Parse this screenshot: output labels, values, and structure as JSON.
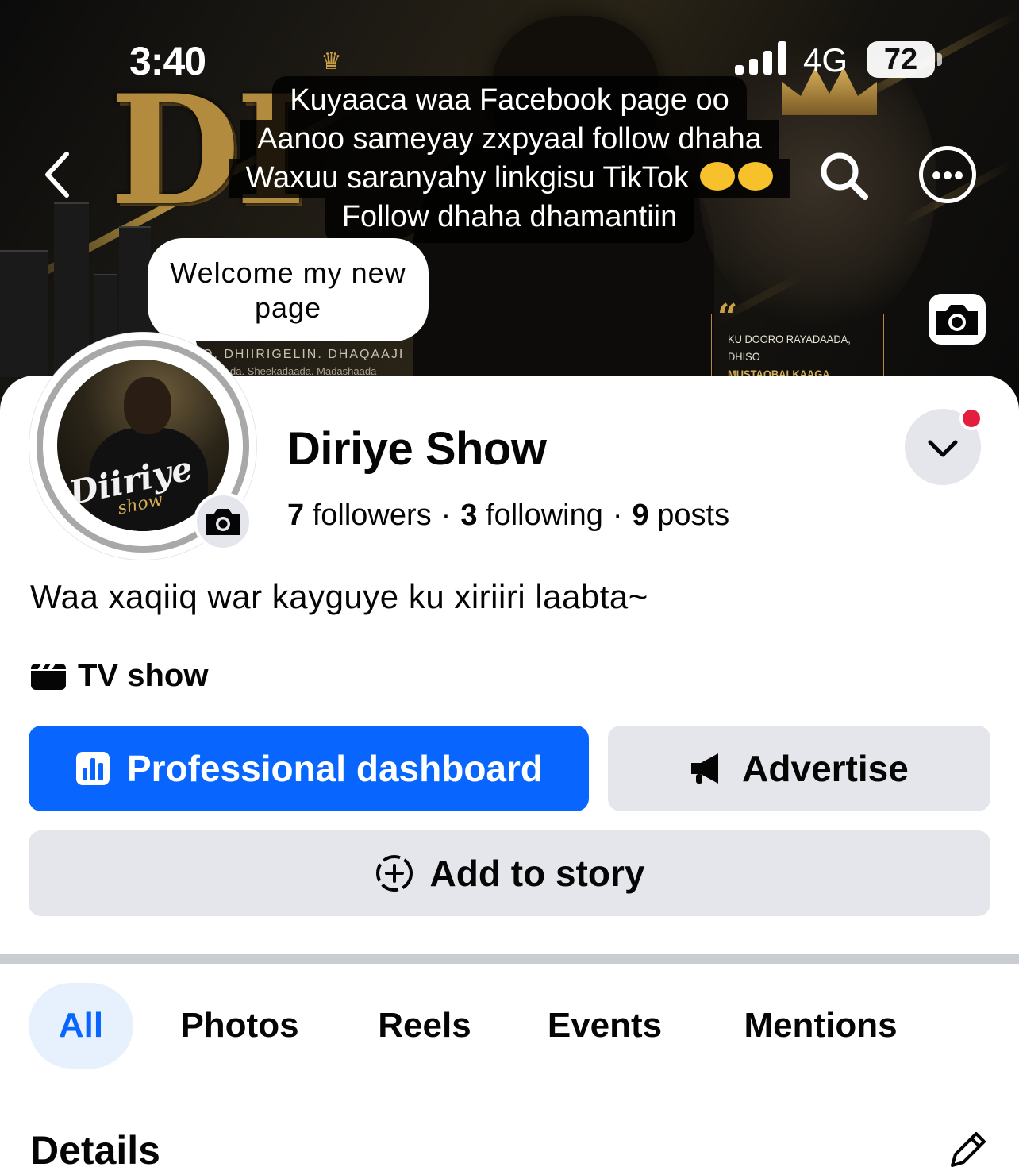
{
  "status_bar": {
    "time": "3:40",
    "network": "4G",
    "battery": "72"
  },
  "cover": {
    "big_letters": "DI",
    "strip_text": "O. DHIIRIGELIN. DHAQAAJI",
    "strip_text_2": "da. Sheekadaada. Madashaada —",
    "quote_line_1": "KU DOORO RAYADAADA,",
    "quote_line_2_prefix": "DHISO ",
    "quote_line_2_highlight": "MUSTAQBALKAAGA."
  },
  "overlay_caption": {
    "lines": [
      "Kuyaaca waa Facebook page oo",
      "Aanoo sameyay zxpyaal follow dhaha",
      "Waxuu saranyahy linkgisu TikTok",
      "Follow dhaha dhamantiin"
    ]
  },
  "welcome_bubble": {
    "text_line_1": "Welcome my new",
    "text_line_2": "page"
  },
  "avatar": {
    "signature": "Diiriye",
    "signature_sub": "show"
  },
  "profile": {
    "name": "Diriye Show",
    "followers_count": "7",
    "followers_label": "followers",
    "following_count": "3",
    "following_label": "following",
    "posts_count": "9",
    "posts_label": "posts",
    "separator": "·",
    "bio": "Waa xaqiiq war kayguye ku xiriiri laabta~",
    "category": "TV show"
  },
  "actions": {
    "dashboard_label": "Professional dashboard",
    "advertise_label": "Advertise",
    "add_story_label": "Add to story"
  },
  "tabs": [
    {
      "label": "All",
      "active": true
    },
    {
      "label": "Photos",
      "active": false
    },
    {
      "label": "Reels",
      "active": false
    },
    {
      "label": "Events",
      "active": false
    },
    {
      "label": "Mentions",
      "active": false
    }
  ],
  "details": {
    "title": "Details"
  },
  "icons": {
    "back": "chevron-left-icon",
    "search": "search-icon",
    "more": "more-icon",
    "camera": "camera-icon",
    "chevron": "chevron-down-icon",
    "category": "clapperboard-icon",
    "dashboard": "bar-chart-icon",
    "advertise": "megaphone-icon",
    "story": "add-circle-icon",
    "edit": "pencil-icon"
  },
  "colors": {
    "accent": "#0866ff",
    "accent_light": "#e7f0fd",
    "button_gray": "#e4e6eb",
    "notification": "#e41e3f",
    "cover_gold": "#c9a046"
  }
}
